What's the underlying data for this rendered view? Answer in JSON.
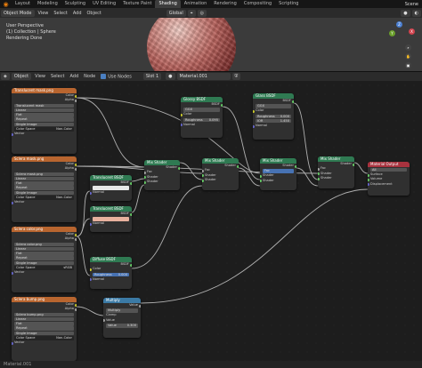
{
  "topbar": {
    "tabs": [
      "Layout",
      "Modeling",
      "Sculpting",
      "UV Editing",
      "Texture Paint",
      "Shading",
      "Animation",
      "Rendering",
      "Compositing",
      "Scripting"
    ],
    "scene": "Scene"
  },
  "viewport_header": {
    "mode": "Object Mode",
    "menus": [
      "View",
      "Select",
      "Add",
      "Object"
    ],
    "orientation": "Global"
  },
  "viewport": {
    "line1": "User Perspective",
    "line2": "(1) Collection | Sphere",
    "line3": "Rendering Done",
    "gizmo": {
      "x": "X",
      "y": "Y",
      "z": "Z"
    }
  },
  "node_header": {
    "type": "Object",
    "menus": [
      "View",
      "Select",
      "Add",
      "Node"
    ],
    "use_nodes": "Use Nodes",
    "slot": "Slot 1",
    "material": "Material.001"
  },
  "status": "Material.001",
  "nodes": {
    "tex1": {
      "title": "Translucent mask.png",
      "out_color": "Color",
      "out_alpha": "Alpha",
      "image": "Translucent mask",
      "interp": "Linear",
      "proj": "Flat",
      "ext": "Repeat",
      "source": "Single Image",
      "cs_label": "Color Space",
      "cs": "Non-Color",
      "vector": "Vector"
    },
    "tex2": {
      "title": "Sclera mask.png",
      "out_color": "Color",
      "out_alpha": "Alpha",
      "image": "Sclera mask.png",
      "interp": "Linear",
      "proj": "Flat",
      "ext": "Repeat",
      "source": "Single Image",
      "cs_label": "Color Space",
      "cs": "Non-Color",
      "vector": "Vector"
    },
    "tex3": {
      "title": "Sclera color.png",
      "out_color": "Color",
      "out_alpha": "Alpha",
      "image": "Sclera color.png",
      "interp": "Linear",
      "proj": "Flat",
      "ext": "Repeat",
      "source": "Single Image",
      "cs_label": "Color Space",
      "cs": "sRGB",
      "vector": "Vector"
    },
    "tex4": {
      "title": "Sclera bump.png",
      "out_color": "Color",
      "out_alpha": "Alpha",
      "image": "Sclera bump.png",
      "interp": "Linear",
      "proj": "Flat",
      "ext": "Repeat",
      "source": "Single Image",
      "cs_label": "Color Space",
      "cs": "Non-Color",
      "vector": "Vector"
    },
    "trans1": {
      "title": "Translucent BSDF",
      "out": "BSDF",
      "color": "Color",
      "normal": "Normal"
    },
    "trans2": {
      "title": "Translucent BSDF",
      "out": "BSDF",
      "color": "Color",
      "normal": "Normal"
    },
    "diffuse": {
      "title": "Diffuse BSDF",
      "out": "BSDF",
      "color": "Color",
      "roughness": "Roughness",
      "roughness_val": "0.000",
      "normal": "Normal"
    },
    "glossy": {
      "title": "Glossy BSDF",
      "out": "BSDF",
      "dist": "GGX",
      "color": "Color",
      "roughness": "Roughness",
      "roughness_val": "0.095",
      "normal": "Normal"
    },
    "sss": {
      "title": "Glass BSDF",
      "out": "BSDF",
      "dist": "GGX",
      "color": "Color",
      "roughness": "Roughness",
      "roughness_val": "0.000",
      "ior": "IOR",
      "ior_val": "1.450",
      "normal": "Normal"
    },
    "mix1": {
      "title": "Mix Shader",
      "out": "Shader",
      "fac": "Fac",
      "s1": "Shader",
      "s2": "Shader"
    },
    "mix2": {
      "title": "Mix Shader",
      "out": "Shader",
      "fac": "Fac",
      "s1": "Shader",
      "s2": "Shader"
    },
    "mix3": {
      "title": "Mix Shader",
      "out": "Shader",
      "fac": "Fac",
      "s1": "Shader",
      "s2": "Shader"
    },
    "mix4": {
      "title": "Mix Shader",
      "out": "Shader",
      "fac": "Fac",
      "s1": "Shader",
      "s2": "Shader"
    },
    "multiply": {
      "title": "Multiply",
      "out": "Value",
      "op": "Multiply",
      "clamp": "Clamp",
      "v1": "Value",
      "v2_label": "Value",
      "v2": "0.300"
    },
    "output": {
      "title": "Material Output",
      "target": "All",
      "surface": "Surface",
      "volume": "Volume",
      "displacement": "Displacement"
    }
  }
}
